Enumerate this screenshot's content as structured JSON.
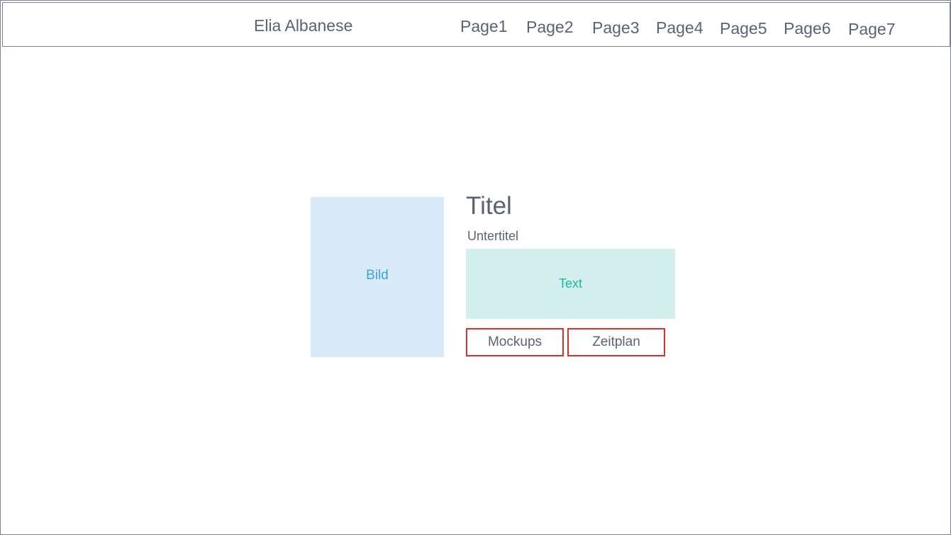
{
  "header": {
    "brand": "Elia Albanese",
    "nav": [
      {
        "label": "Page1"
      },
      {
        "label": "Page2"
      },
      {
        "label": "Page3"
      },
      {
        "label": "Page4"
      },
      {
        "label": "Page5"
      },
      {
        "label": "Page6"
      },
      {
        "label": "Page7"
      }
    ]
  },
  "content": {
    "image_label": "Bild",
    "title": "Titel",
    "subtitle": "Untertitel",
    "text_label": "Text",
    "buttons": {
      "mockups": "Mockups",
      "zeitplan": "Zeitplan"
    }
  },
  "colors": {
    "text": "#5b6275",
    "border": "#7d8193",
    "image_bg": "#d9ebf9",
    "image_label": "#3ea2dc",
    "text_bg": "#d3f0ee",
    "text_label": "#20b3a6",
    "button_border": "#d9312d"
  }
}
